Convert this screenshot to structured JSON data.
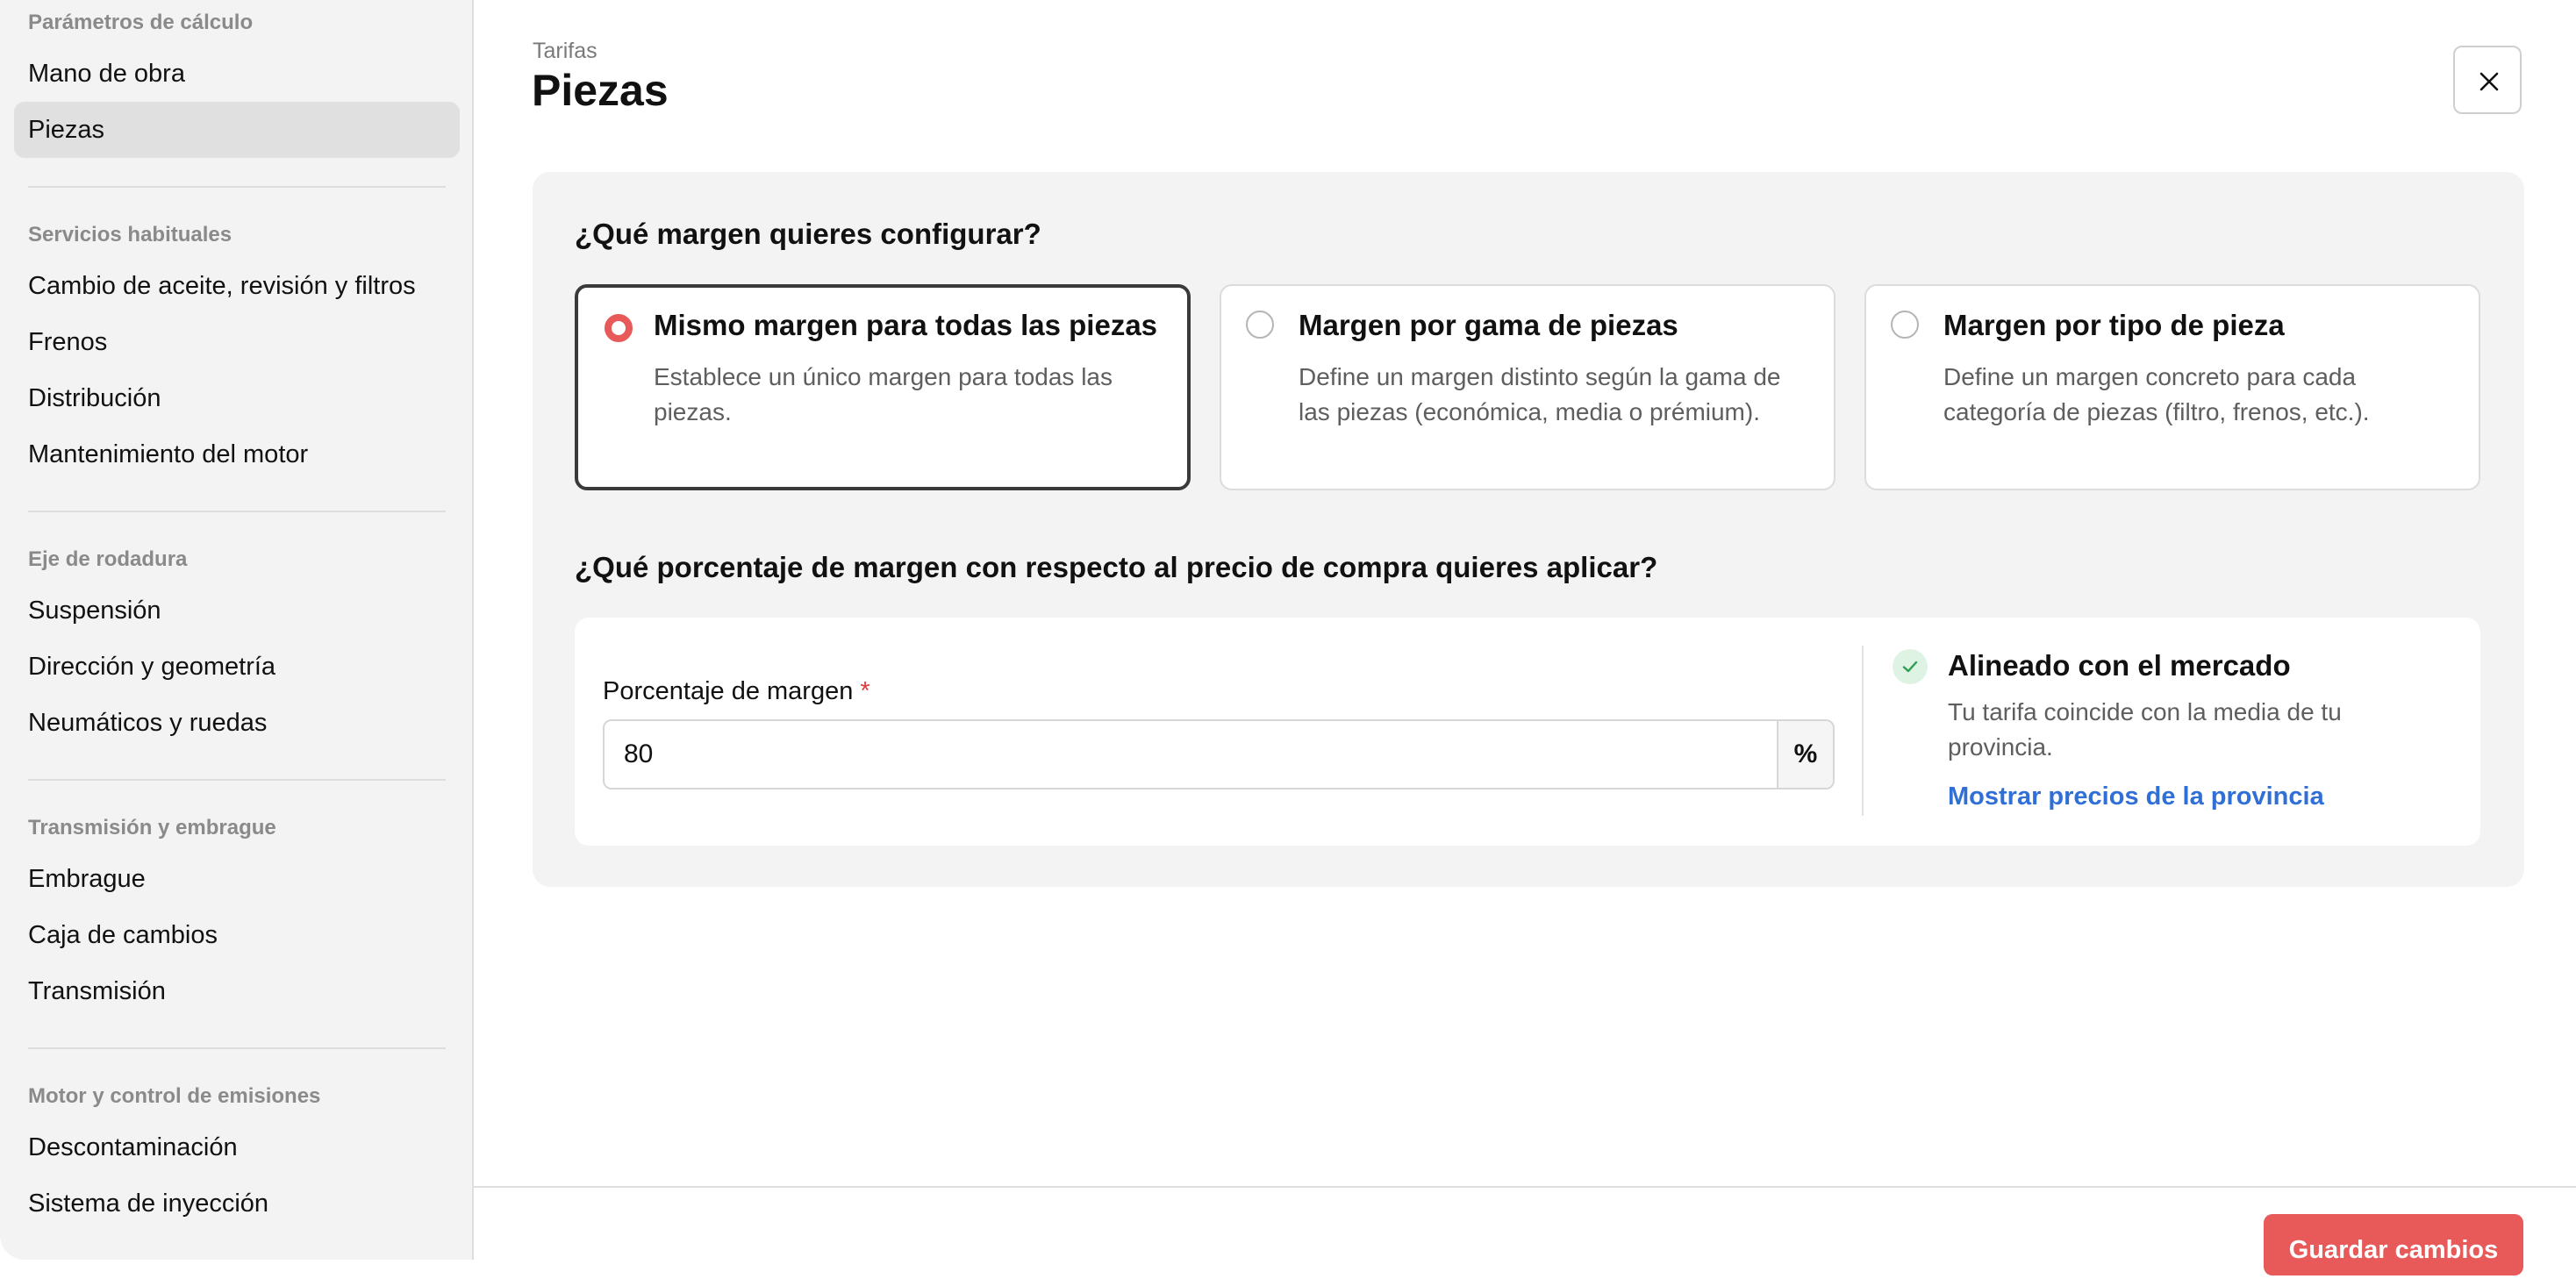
{
  "sidebar": {
    "sections": [
      {
        "title": "Parámetros de cálculo",
        "items": [
          "Mano de obra",
          "Piezas"
        ]
      },
      {
        "title": "Servicios habituales",
        "items": [
          "Cambio de aceite, revisión y filtros",
          "Frenos",
          "Distribución",
          "Mantenimiento del motor"
        ]
      },
      {
        "title": "Eje de rodadura",
        "items": [
          "Suspensión",
          "Dirección y geometría",
          "Neumáticos y ruedas"
        ]
      },
      {
        "title": "Transmisión y embrague",
        "items": [
          "Embrague",
          "Caja de cambios",
          "Transmisión"
        ]
      },
      {
        "title": "Motor y control de emisiones",
        "items": [
          "Descontaminación",
          "Sistema de inyección"
        ]
      }
    ],
    "active_item": "Piezas"
  },
  "header": {
    "breadcrumb": "Tarifas",
    "title": "Piezas",
    "close_icon": "close-icon"
  },
  "margin_type": {
    "question": "¿Qué margen quieres configurar?",
    "options": [
      {
        "title": "Mismo margen para todas las piezas",
        "description": "Establece un único margen para todas las piezas.",
        "selected": true
      },
      {
        "title": "Margen por gama de piezas",
        "description": "Define un margen distinto según la gama de las piezas (económica, media o prémium).",
        "selected": false
      },
      {
        "title": "Margen por tipo de pieza",
        "description": "Define un margen concreto para cada categoría de piezas (filtro, frenos, etc.).",
        "selected": false
      }
    ]
  },
  "margin_percentage": {
    "question": "¿Qué porcentaje de margen con respecto al precio de compra quieres aplicar?",
    "label": "Porcentaje de margen",
    "required_mark": "*",
    "value": "80",
    "suffix": "%"
  },
  "market_status": {
    "title": "Alineado con el mercado",
    "description": "Tu tarifa coincide con la media de tu provincia.",
    "link": "Mostrar precios de la provincia",
    "icon": "check-icon"
  },
  "footer": {
    "save_label": "Guardar cambios"
  },
  "colors": {
    "accent": "#e85a5a",
    "link": "#2f6fd6",
    "success_bg": "#dff3e4",
    "success": "#2e9e4f"
  }
}
